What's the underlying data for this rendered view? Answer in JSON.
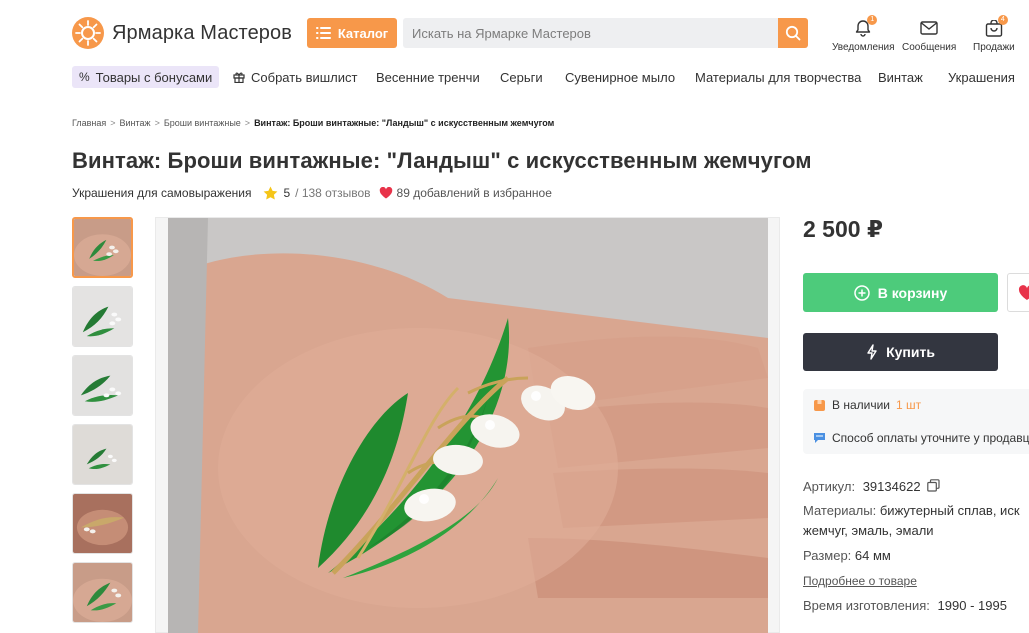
{
  "header": {
    "logo_text": "Ярмарка Мастеров",
    "catalog_label": "Каталог",
    "search_placeholder": "Искать на Ярмарке Мастеров",
    "notifications_label": "Уведомления",
    "notifications_count": "1",
    "messages_label": "Сообщения",
    "sales_label": "Продажи",
    "sales_count": "4"
  },
  "nav": {
    "items": [
      {
        "label": "Товары с бонусами",
        "icon": "percent-icon"
      },
      {
        "label": "Собрать вишлист",
        "icon": "gift-icon"
      },
      {
        "label": "Весенние тренчи"
      },
      {
        "label": "Серьги"
      },
      {
        "label": "Сувенирное мыло"
      },
      {
        "label": "Материалы для творчества"
      },
      {
        "label": "Винтаж"
      },
      {
        "label": "Украшения"
      }
    ]
  },
  "breadcrumbs": {
    "items": [
      "Главная",
      "Винтаж",
      "Броши винтажные",
      "Винтаж: Броши винтажные: \"Ландыш\" с искусственным жемчугом"
    ],
    "separator": ">"
  },
  "product": {
    "title": "Винтаж: Броши винтажные: \"Ландыш\" с искусственным жемчугом",
    "shop": "Украшения для самовыражения",
    "rating": "5",
    "reviews": "/ 138 отзывов",
    "favorites": "89 добавлений в избранное",
    "price": "2 500 ₽",
    "cart_label": "В корзину",
    "buy_label": "Купить",
    "stock_label": "В наличии",
    "stock_qty": "1 шт",
    "payment_note": "Способ оплаты уточните у продавца",
    "article_label": "Артикул:",
    "article_value": "39134622",
    "materials_label": "Материалы:",
    "materials_value": "бижутерный сплав, иск",
    "materials_value_2": "жемчуг, эмаль, эмали",
    "size_label": "Размер:",
    "size_value": "64 мм",
    "more_link": "Подробнее о товаре",
    "production_label": "Время изготовления:",
    "production_value": "1990 - 1995"
  },
  "colors": {
    "accent": "#f7984a",
    "cart": "#4dcb7b",
    "buy": "#333640",
    "promo_bg": "#ebe5f8",
    "heart": "#e8334a",
    "star": "#f5c518"
  }
}
